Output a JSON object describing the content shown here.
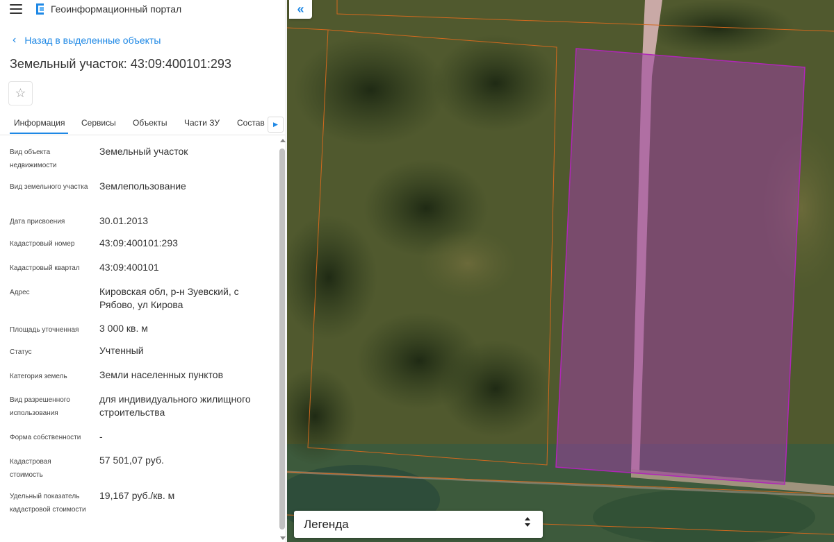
{
  "header": {
    "app_title": "Геоинформационный портал",
    "menu_icon": "hamburger-icon",
    "logo_icon": "portal-logo-icon"
  },
  "back_link": {
    "label": "Назад в выделенные объекты",
    "icon": "chevron-left-icon"
  },
  "page_title": "Земельный участок: 43:09:400101:293",
  "favorite_icon": "star-icon",
  "tabs": [
    {
      "label": "Информация",
      "active": true
    },
    {
      "label": "Сервисы"
    },
    {
      "label": "Объекты"
    },
    {
      "label": "Части ЗУ"
    },
    {
      "label": "Состав"
    }
  ],
  "tab_scroll_icon": "chevron-right-icon",
  "properties": [
    {
      "label": "Вид объекта недвижимости",
      "value": "Земельный участок"
    },
    {
      "label": "Вид земельного участка",
      "value": "Землепользование"
    },
    {
      "label": "Дата присвоения",
      "value": "30.01.2013"
    },
    {
      "label": "Кадастровый номер",
      "value": "43:09:400101:293"
    },
    {
      "label": "Кадастровый квартал",
      "value": "43:09:400101"
    },
    {
      "label": "Адрес",
      "value": "Кировская обл, р-н Зуевский, с Рябово, ул Кирова"
    },
    {
      "label": "Площадь уточненная",
      "value": "3 000 кв. м"
    },
    {
      "label": "Статус",
      "value": "Учтенный"
    },
    {
      "label": "Категория земель",
      "value": "Земли населенных пунктов"
    },
    {
      "label": "Вид разрешенного использования",
      "value": "для индивидуального жилищного строительства"
    },
    {
      "label": "Форма собственности",
      "value": "-"
    },
    {
      "label": "Кадастровая стоимость",
      "value": "57 501,07 руб."
    },
    {
      "label": "Удельный показатель кадастровой стоимости",
      "value": "19,167 руб./кв. м"
    }
  ],
  "map": {
    "collapse_icon": "double-chevron-left-icon",
    "legend_label": "Легенда",
    "legend_icon": "up-down-chevron-icon",
    "colors": {
      "selected_parcel_fill": "#9b3fa0",
      "selected_parcel_border": "#b026b8",
      "parcel_border": "#d2691e",
      "road": "#c9a9a6"
    }
  }
}
